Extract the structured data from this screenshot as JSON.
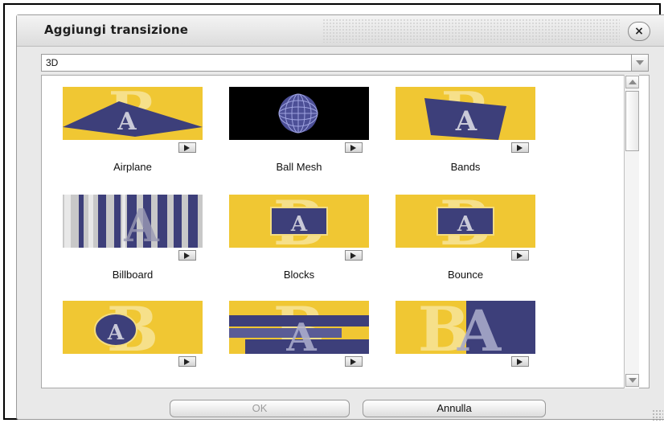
{
  "dialog": {
    "title": "Aggiungi transizione",
    "close_label": "×"
  },
  "category_select": {
    "selected": "3D"
  },
  "transitions": [
    {
      "label": "Airplane",
      "icon": "airplane-transition-thumbnail"
    },
    {
      "label": "Ball Mesh",
      "icon": "ball-mesh-transition-thumbnail"
    },
    {
      "label": "Bands",
      "icon": "bands-transition-thumbnail"
    },
    {
      "label": "Billboard",
      "icon": "billboard-transition-thumbnail"
    },
    {
      "label": "Blocks",
      "icon": "blocks-transition-thumbnail"
    },
    {
      "label": "Bounce",
      "icon": "bounce-transition-thumbnail"
    },
    {
      "label": "",
      "icon": "circle-transition-thumbnail"
    },
    {
      "label": "",
      "icon": "slats-transition-thumbnail"
    },
    {
      "label": "",
      "icon": "split-transition-thumbnail"
    }
  ],
  "buttons": {
    "ok": "OK",
    "cancel": "Annulla"
  },
  "colors": {
    "thumb_yellow": "#f0c733",
    "thumb_blue": "#3d3f7a",
    "dialog_bg": "#e9e9e9"
  }
}
